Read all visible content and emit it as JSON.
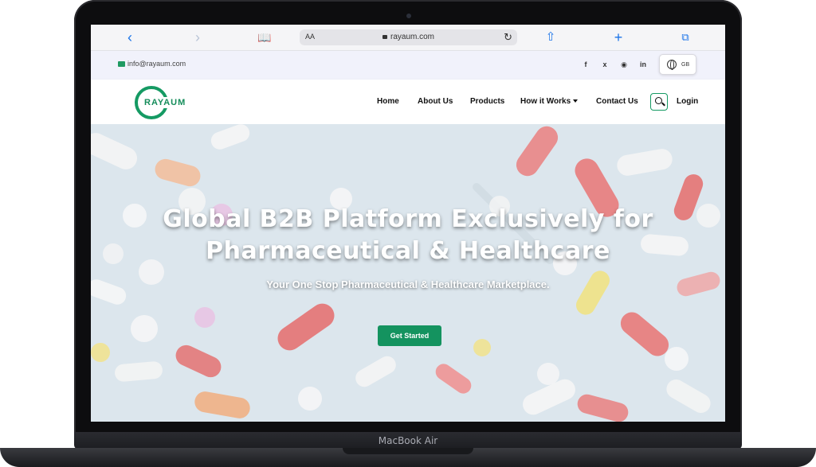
{
  "device": {
    "label": "MacBook Air"
  },
  "browser": {
    "text_size_label": "AA",
    "url": "rayaum.com",
    "icons": [
      "chevron-left-icon",
      "chevron-right-icon",
      "book-icon",
      "lock-icon",
      "reload-icon",
      "share-icon",
      "plus-icon",
      "tabs-icon"
    ]
  },
  "topbar": {
    "email": "info@rayaum.com",
    "social": [
      "facebook-icon",
      "twitter-icon",
      "instagram-icon",
      "linkedin-icon"
    ],
    "language": "GB"
  },
  "nav": {
    "logo_text": "RAYAUM",
    "items": [
      "Home",
      "About Us",
      "Products",
      "How it Works",
      "Contact Us"
    ],
    "login": "Login"
  },
  "hero": {
    "title_line1": "Global B2B Platform Exclusively for",
    "title_line2": "Pharmaceutical & Healthcare",
    "subtitle": "Your One Stop Pharmaceutical & Healthcare Marketplace.",
    "cta": "Get Started"
  },
  "colors": {
    "brand_green": "#14935f",
    "link_blue": "#1a73e8",
    "topbar_bg": "#f1f2fb"
  }
}
